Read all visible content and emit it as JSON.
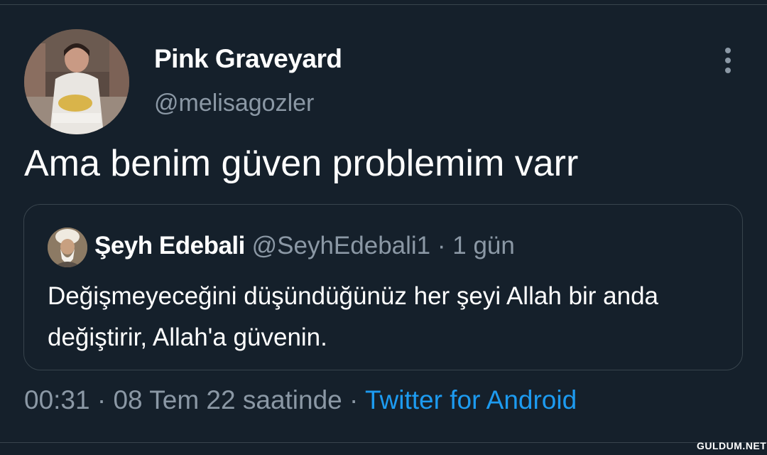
{
  "tweet": {
    "display_name": "Pink Graveyard",
    "handle": "@melisagozler",
    "text": "Ama benim güven problemim varr",
    "timestamp": "00:31",
    "date": "08 Tem 22 saatinde",
    "separator": "·",
    "source": "Twitter for Android"
  },
  "quoted_tweet": {
    "display_name": "Şeyh Edebali",
    "handle": "@SeyhEdebali1",
    "separator": "·",
    "time_ago": "1 gün",
    "text": "Değişmeyeceğini düşündüğünüz her şeyi Allah bir anda değiştirir, Allah'a güvenin."
  },
  "watermark": "GULDUM.NET",
  "icons": {
    "more": "more-vertical-icon"
  },
  "colors": {
    "background": "#15202b",
    "secondary_text": "#8b98a5",
    "link": "#1d9bf0",
    "border": "#38444d"
  }
}
